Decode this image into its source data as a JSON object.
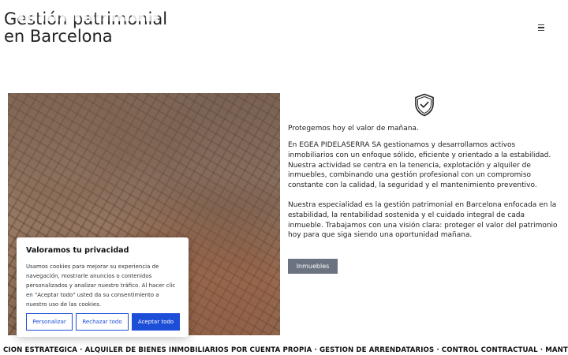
{
  "header": {
    "title_line1": "Gestión patrimonial",
    "title_line2": "en Barcelona",
    "menu_icon": "hamburger-menu-icon"
  },
  "main": {
    "image_alt": "Vista aérea de Barcelona con la Sagrada Familia",
    "feature_icon": "shield-check-icon",
    "paragraph1": "Protegemos hoy el valor de mañana.",
    "paragraph2": "En EGEA PIDELASERRA SA gestionamos y desarrollamos activos inmobiliarios con un enfoque sólido, eficiente y orientado a la estabilidad. Nuestra actividad se centra en la tenencia, explotación y alquiler de inmuebles, combinando una gestión profesional con un compromiso constante con la calidad, la seguridad y el mantenimiento preventivo.",
    "paragraph3": "Nuestra especialidad es la gestión patrimonial en Barcelona enfocada en la estabilidad, la rentabilidad sostenida y el cuidado integral de cada inmueble. Trabajamos con una visión clara: proteger el valor del patrimonio hoy para que siga siendo una oportunidad mañana.",
    "cta_label": "Inmuebles"
  },
  "cookie_banner": {
    "title": "Valoramos tu privacidad",
    "body": "Usamos cookies para mejorar su experiencia de navegación, mostrarle anuncios o contenidos personalizados y analizar nuestro tráfico. Al hacer clic en \"Aceptar todo\" usted da su consentimiento a nuestro uso de las cookies.",
    "customize_label": "Personalizar",
    "reject_label": "Rechazar todo",
    "accept_label": "Aceptar todo"
  },
  "ticker": {
    "text": "CIÓN ESTRATÉGICA · ALQUILER DE BIENES INMOBILIARIOS POR CUENTA PROPIA · GESTIÓN DE ARRENDATARIOS · CONTROL CONTRACTUAL · MANTENIMIENTO"
  },
  "colors": {
    "primary_button": "#1d4ed8",
    "cta_button": "#6b7280"
  }
}
